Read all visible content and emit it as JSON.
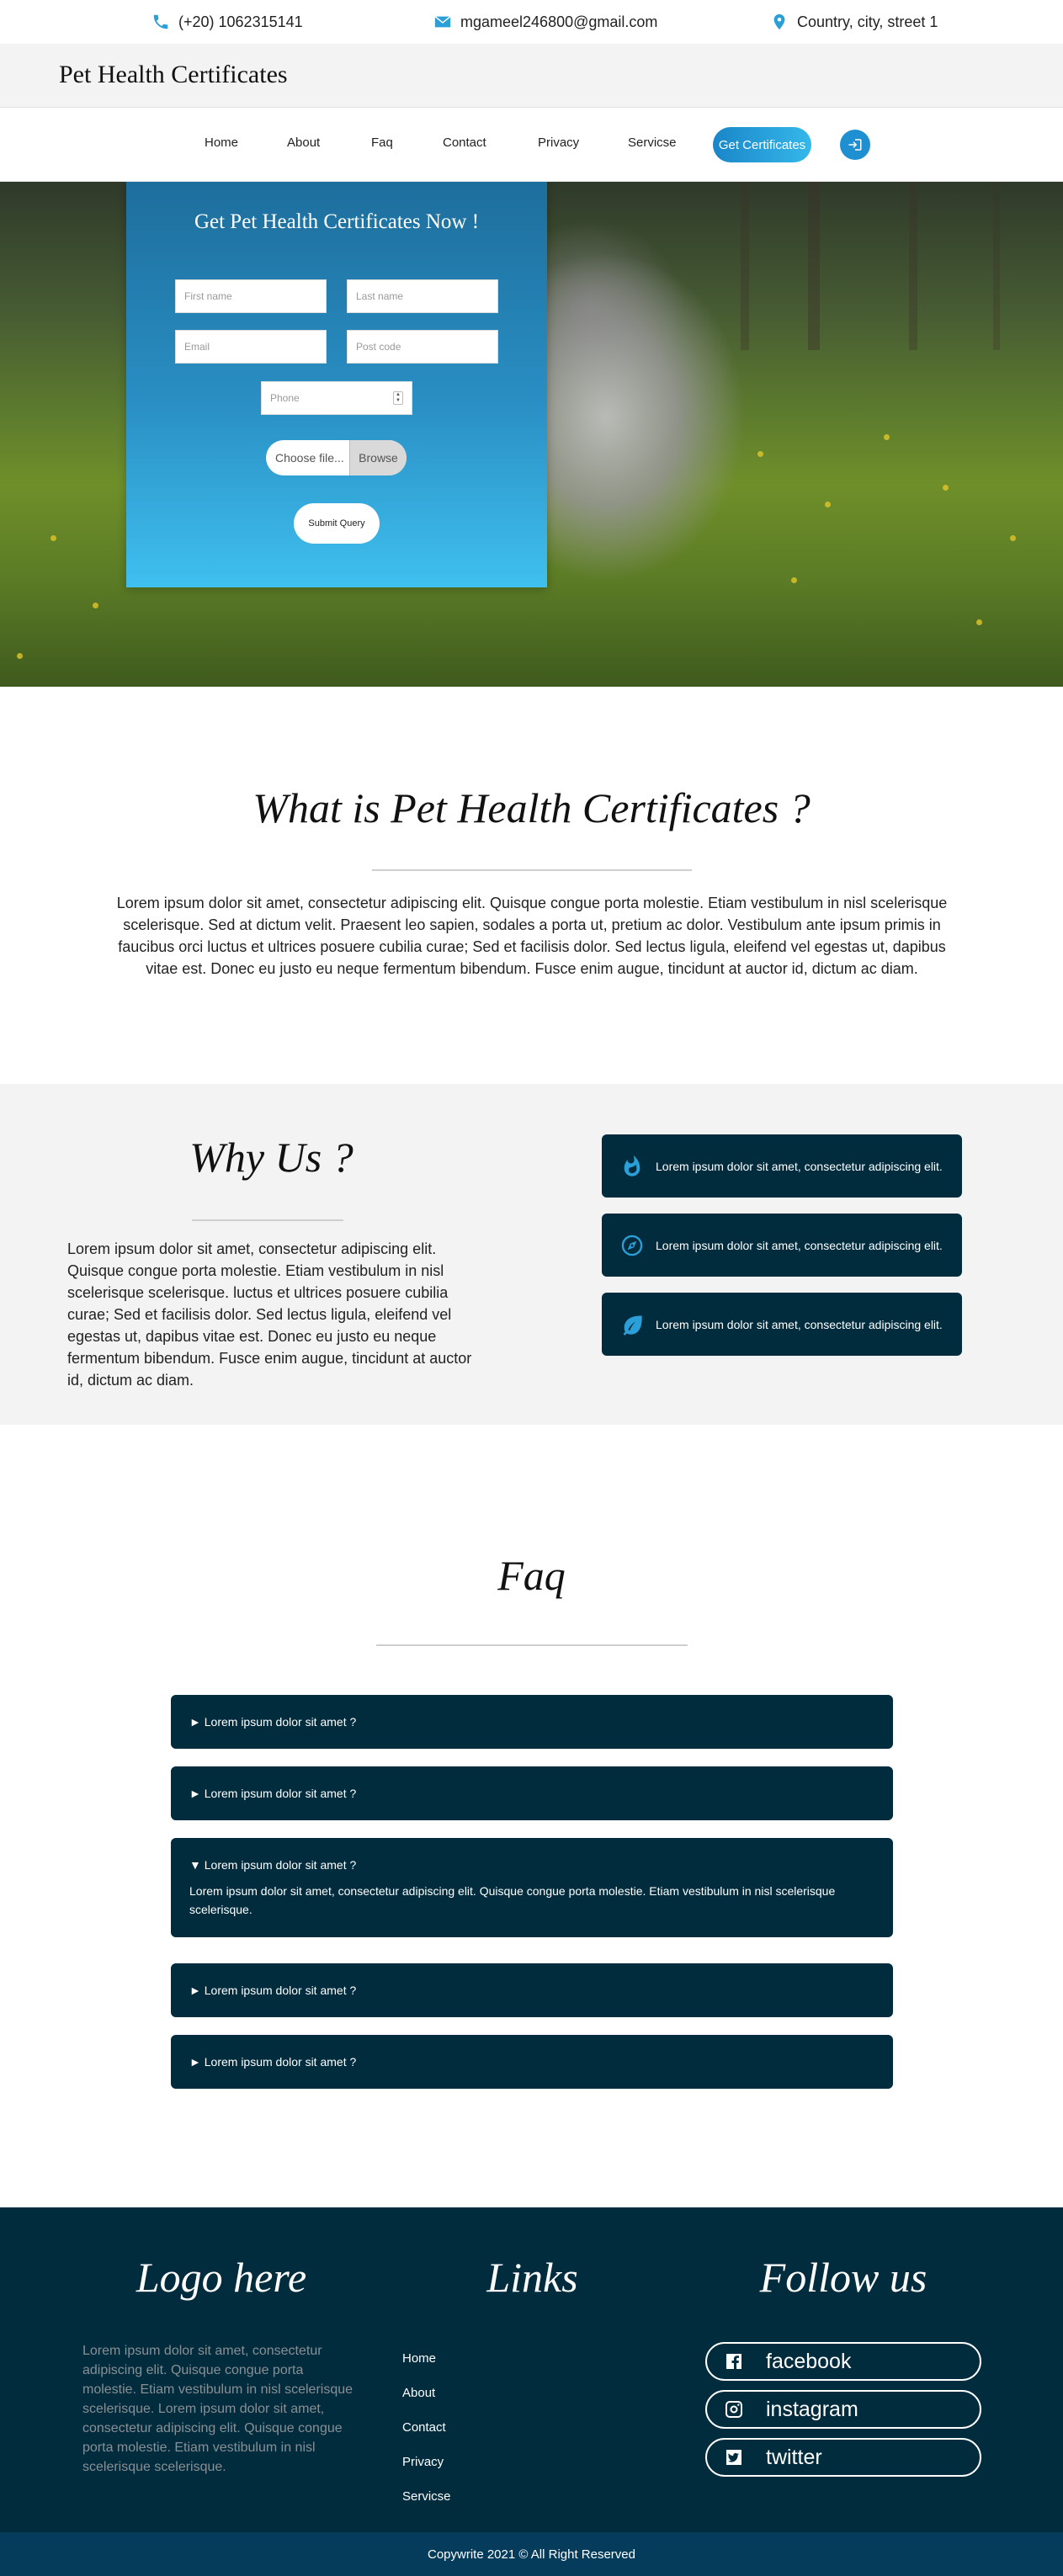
{
  "topbar": {
    "phone": "(+20) 1062315141",
    "email": "mgameel246800@gmail.com",
    "location": "Country, city, street 1",
    "icon_color": "#2a9fd8"
  },
  "brand": "Pet Health Certificates",
  "nav": {
    "items": [
      "Home",
      "About",
      "Faq",
      "Contact",
      "Privacy",
      "Servicse"
    ],
    "cta": "Get Certificates",
    "login_icon": "sign-in-icon"
  },
  "form": {
    "title": "Get Pet Health Certificates Now !",
    "first_name_placeholder": "First name",
    "last_name_placeholder": "Last name",
    "email_placeholder": "Email",
    "post_code_placeholder": "Post code",
    "phone_placeholder": "Phone",
    "file_text": "Choose file...",
    "browse": "Browse",
    "submit": "Submit Query"
  },
  "what": {
    "title": "What is Pet Health Certificates ?",
    "text": "Lorem ipsum dolor sit amet, consectetur adipiscing elit. Quisque congue porta molestie. Etiam vestibulum in nisl scelerisque scelerisque. Sed at dictum velit. Praesent leo sapien, sodales a porta ut, pretium ac dolor. Vestibulum ante ipsum primis in faucibus orci luctus et ultrices posuere cubilia curae; Sed et facilisis dolor. Sed lectus ligula, eleifend vel egestas ut, dapibus vitae est. Donec eu justo eu neque fermentum bibendum. Fusce enim augue, tincidunt at auctor id, dictum ac diam."
  },
  "why": {
    "title": "Why Us ?",
    "text": "Lorem ipsum dolor sit amet, consectetur adipiscing elit. Quisque congue porta molestie. Etiam vestibulum in nisl scelerisque scelerisque. luctus et ultrices posuere cubilia curae; Sed et facilisis dolor. Sed lectus ligula, eleifend vel egestas ut, dapibus vitae est. Donec eu justo eu neque fermentum bibendum. Fusce enim augue, tincidunt at auctor id, dictum ac diam.",
    "features": [
      {
        "icon": "fire-icon",
        "text": "Lorem ipsum dolor sit amet, consectetur adipiscing elit."
      },
      {
        "icon": "compass-icon",
        "text": "Lorem ipsum dolor sit amet, consectetur adipiscing elit."
      },
      {
        "icon": "leaf-icon",
        "text": "Lorem ipsum dolor sit amet, consectetur adipiscing elit."
      }
    ],
    "icon_color": "#2a9fd8"
  },
  "faq": {
    "title": "Faq",
    "items": [
      {
        "question": "► Lorem ipsum dolor sit amet ?"
      },
      {
        "question": "► Lorem ipsum dolor sit amet ?"
      },
      {
        "question": "▼ Lorem ipsum dolor sit amet ?",
        "answer": "Lorem ipsum dolor sit amet, consectetur adipiscing elit. Quisque congue porta molestie. Etiam vestibulum in nisl scelerisque scelerisque."
      },
      {
        "question": "► Lorem ipsum dolor sit amet ?"
      },
      {
        "question": "► Lorem ipsum dolor sit amet ?"
      }
    ]
  },
  "footer": {
    "logo_title": "Logo here",
    "about": "Lorem ipsum dolor sit amet, consectetur adipiscing elit. Quisque congue porta molestie. Etiam vestibulum in nisl scelerisque scelerisque. Lorem ipsum dolor sit amet, consectetur adipiscing elit. Quisque congue porta molestie. Etiam vestibulum in nisl scelerisque scelerisque.",
    "links_title": "Links",
    "links": [
      "Home",
      "About",
      "Contact",
      "Privacy",
      "Servicse"
    ],
    "follow_title": "Follow us",
    "social": [
      {
        "icon": "facebook-icon",
        "label": "facebook"
      },
      {
        "icon": "instagram-icon",
        "label": "instagram"
      },
      {
        "icon": "twitter-icon",
        "label": "twitter"
      }
    ],
    "background": "#002c3e"
  },
  "copyright": "Copywrite 2021 © All Right Reserved"
}
